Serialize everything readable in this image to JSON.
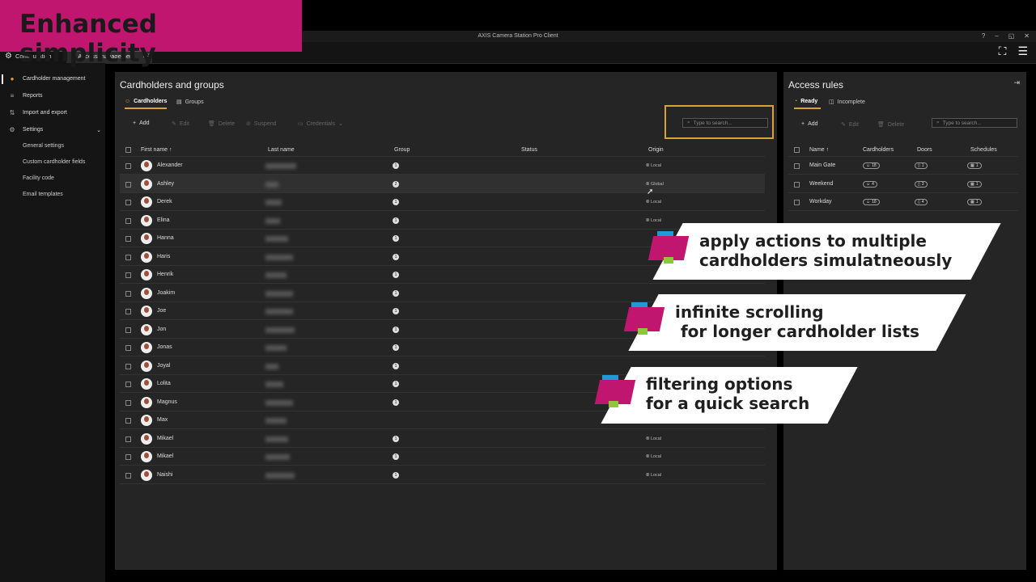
{
  "window": {
    "title": "AXIS Camera Station Pro Client",
    "controls": [
      "?",
      "–",
      "◱",
      "✕"
    ]
  },
  "tabs": [
    {
      "label": "Configuration"
    },
    {
      "label": "Access management"
    }
  ],
  "sidebar": {
    "items": [
      {
        "label": "Cardholder management",
        "icon": "person-icon"
      },
      {
        "label": "Reports",
        "icon": "list-icon"
      },
      {
        "label": "Import and export",
        "icon": "arrows-icon"
      },
      {
        "label": "Settings",
        "icon": "gear-icon"
      },
      {
        "label": "General settings"
      },
      {
        "label": "Custom cardholder fields"
      },
      {
        "label": "Facility code"
      },
      {
        "label": "Email templates"
      }
    ]
  },
  "main": {
    "title": "Cardholders and groups",
    "subtabs": [
      {
        "label": "Cardholders"
      },
      {
        "label": "Groups"
      }
    ],
    "toolbar": {
      "add": "Add",
      "edit": "Edit",
      "delete": "Delete",
      "suspend": "Suspend",
      "credentials": "Credentials"
    },
    "search_placeholder": "Type to search...",
    "columns": {
      "first": "First name ↑",
      "last": "Last name",
      "group": "Group",
      "status": "Status",
      "origin": "Origin"
    },
    "rows": [
      {
        "first": "Alexander",
        "group": "1",
        "origin": "Local"
      },
      {
        "first": "Ashley",
        "group": "2",
        "origin": "Global"
      },
      {
        "first": "Derek",
        "group": "1",
        "origin": "Local"
      },
      {
        "first": "Elina",
        "group": "1",
        "origin": "Local"
      },
      {
        "first": "Hanna",
        "group": "1",
        "origin": ""
      },
      {
        "first": "Haris",
        "group": "1",
        "origin": ""
      },
      {
        "first": "Henrik",
        "group": "1",
        "origin": ""
      },
      {
        "first": "Joakim",
        "group": "1",
        "origin": ""
      },
      {
        "first": "Joe",
        "group": "1",
        "origin": ""
      },
      {
        "first": "Jon",
        "group": "1",
        "origin": ""
      },
      {
        "first": "Jonas",
        "group": "1",
        "origin": ""
      },
      {
        "first": "Joyal",
        "group": "1",
        "origin": ""
      },
      {
        "first": "Lolita",
        "group": "1",
        "origin": ""
      },
      {
        "first": "Magnus",
        "group": "1",
        "origin": ""
      },
      {
        "first": "Max",
        "group": "",
        "origin": ""
      },
      {
        "first": "Mikael",
        "group": "1",
        "origin": "Local"
      },
      {
        "first": "Mikael",
        "group": "1",
        "origin": "Local"
      },
      {
        "first": "Naishi",
        "group": "1",
        "origin": "Local"
      }
    ]
  },
  "access": {
    "title": "Access rules",
    "subtabs": [
      {
        "label": "Ready"
      },
      {
        "label": "Incomplete"
      }
    ],
    "toolbar": {
      "add": "Add",
      "edit": "Edit",
      "delete": "Delete"
    },
    "search_placeholder": "Type to search...",
    "columns": {
      "name": "Name ↑",
      "cardholders": "Cardholders",
      "doors": "Doors",
      "schedules": "Schedules"
    },
    "rows": [
      {
        "name": "Main Gate",
        "cardholders": "18",
        "doors": "1",
        "schedules": "1"
      },
      {
        "name": "Weekend",
        "cardholders": "4",
        "doors": "3",
        "schedules": "1"
      },
      {
        "name": "Workday",
        "cardholders": "18",
        "doors": "4",
        "schedules": "1"
      }
    ]
  },
  "overlay": {
    "banner": "Enhanced simplicity",
    "callouts": [
      {
        "line1": "apply actions to multiple",
        "line2": "cardholders simulatneously"
      },
      {
        "line1": "infinite scrolling",
        "line2": " for longer cardholder lists"
      },
      {
        "line1": "filtering options",
        "line2": "for a quick search"
      }
    ],
    "colors": {
      "magenta": "#c0166f",
      "blue": "#1d9bd7",
      "green": "#8dc63f",
      "highlight": "#d8a23a"
    }
  }
}
